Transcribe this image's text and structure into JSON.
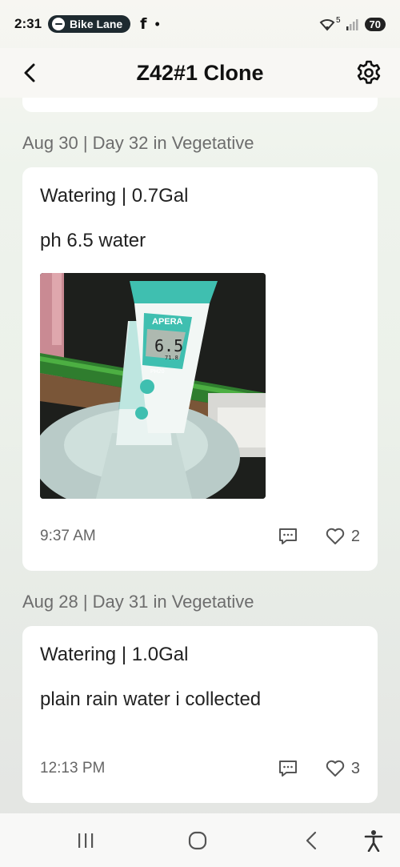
{
  "status_bar": {
    "time": "2:31",
    "media_app": "Bike Lane",
    "social_icon": "f",
    "indicator": "•",
    "network_badge": "5",
    "battery": "70"
  },
  "header": {
    "title": "Z42#1 Clone"
  },
  "entries": [
    {
      "date": "Aug 30 | Day 32 in Vegetative",
      "title": "Watering | 0.7Gal",
      "note": "ph 6.5 water",
      "has_photo": true,
      "time": "9:37 AM",
      "likes": "2"
    },
    {
      "date": "Aug 28 | Day 31 in Vegetative",
      "title": "Watering | 1.0Gal",
      "note": "plain rain water i collected",
      "has_photo": false,
      "time": "12:13 PM",
      "likes": "3"
    }
  ],
  "photo": {
    "brand": "APERA",
    "reading": "6.5",
    "temp": "71.8",
    "model": "PH20"
  },
  "colors": {
    "background": "#eef3ec",
    "card": "#ffffff",
    "muted_text": "#6d6d6d",
    "meter_teal": "#3fbfb0"
  }
}
